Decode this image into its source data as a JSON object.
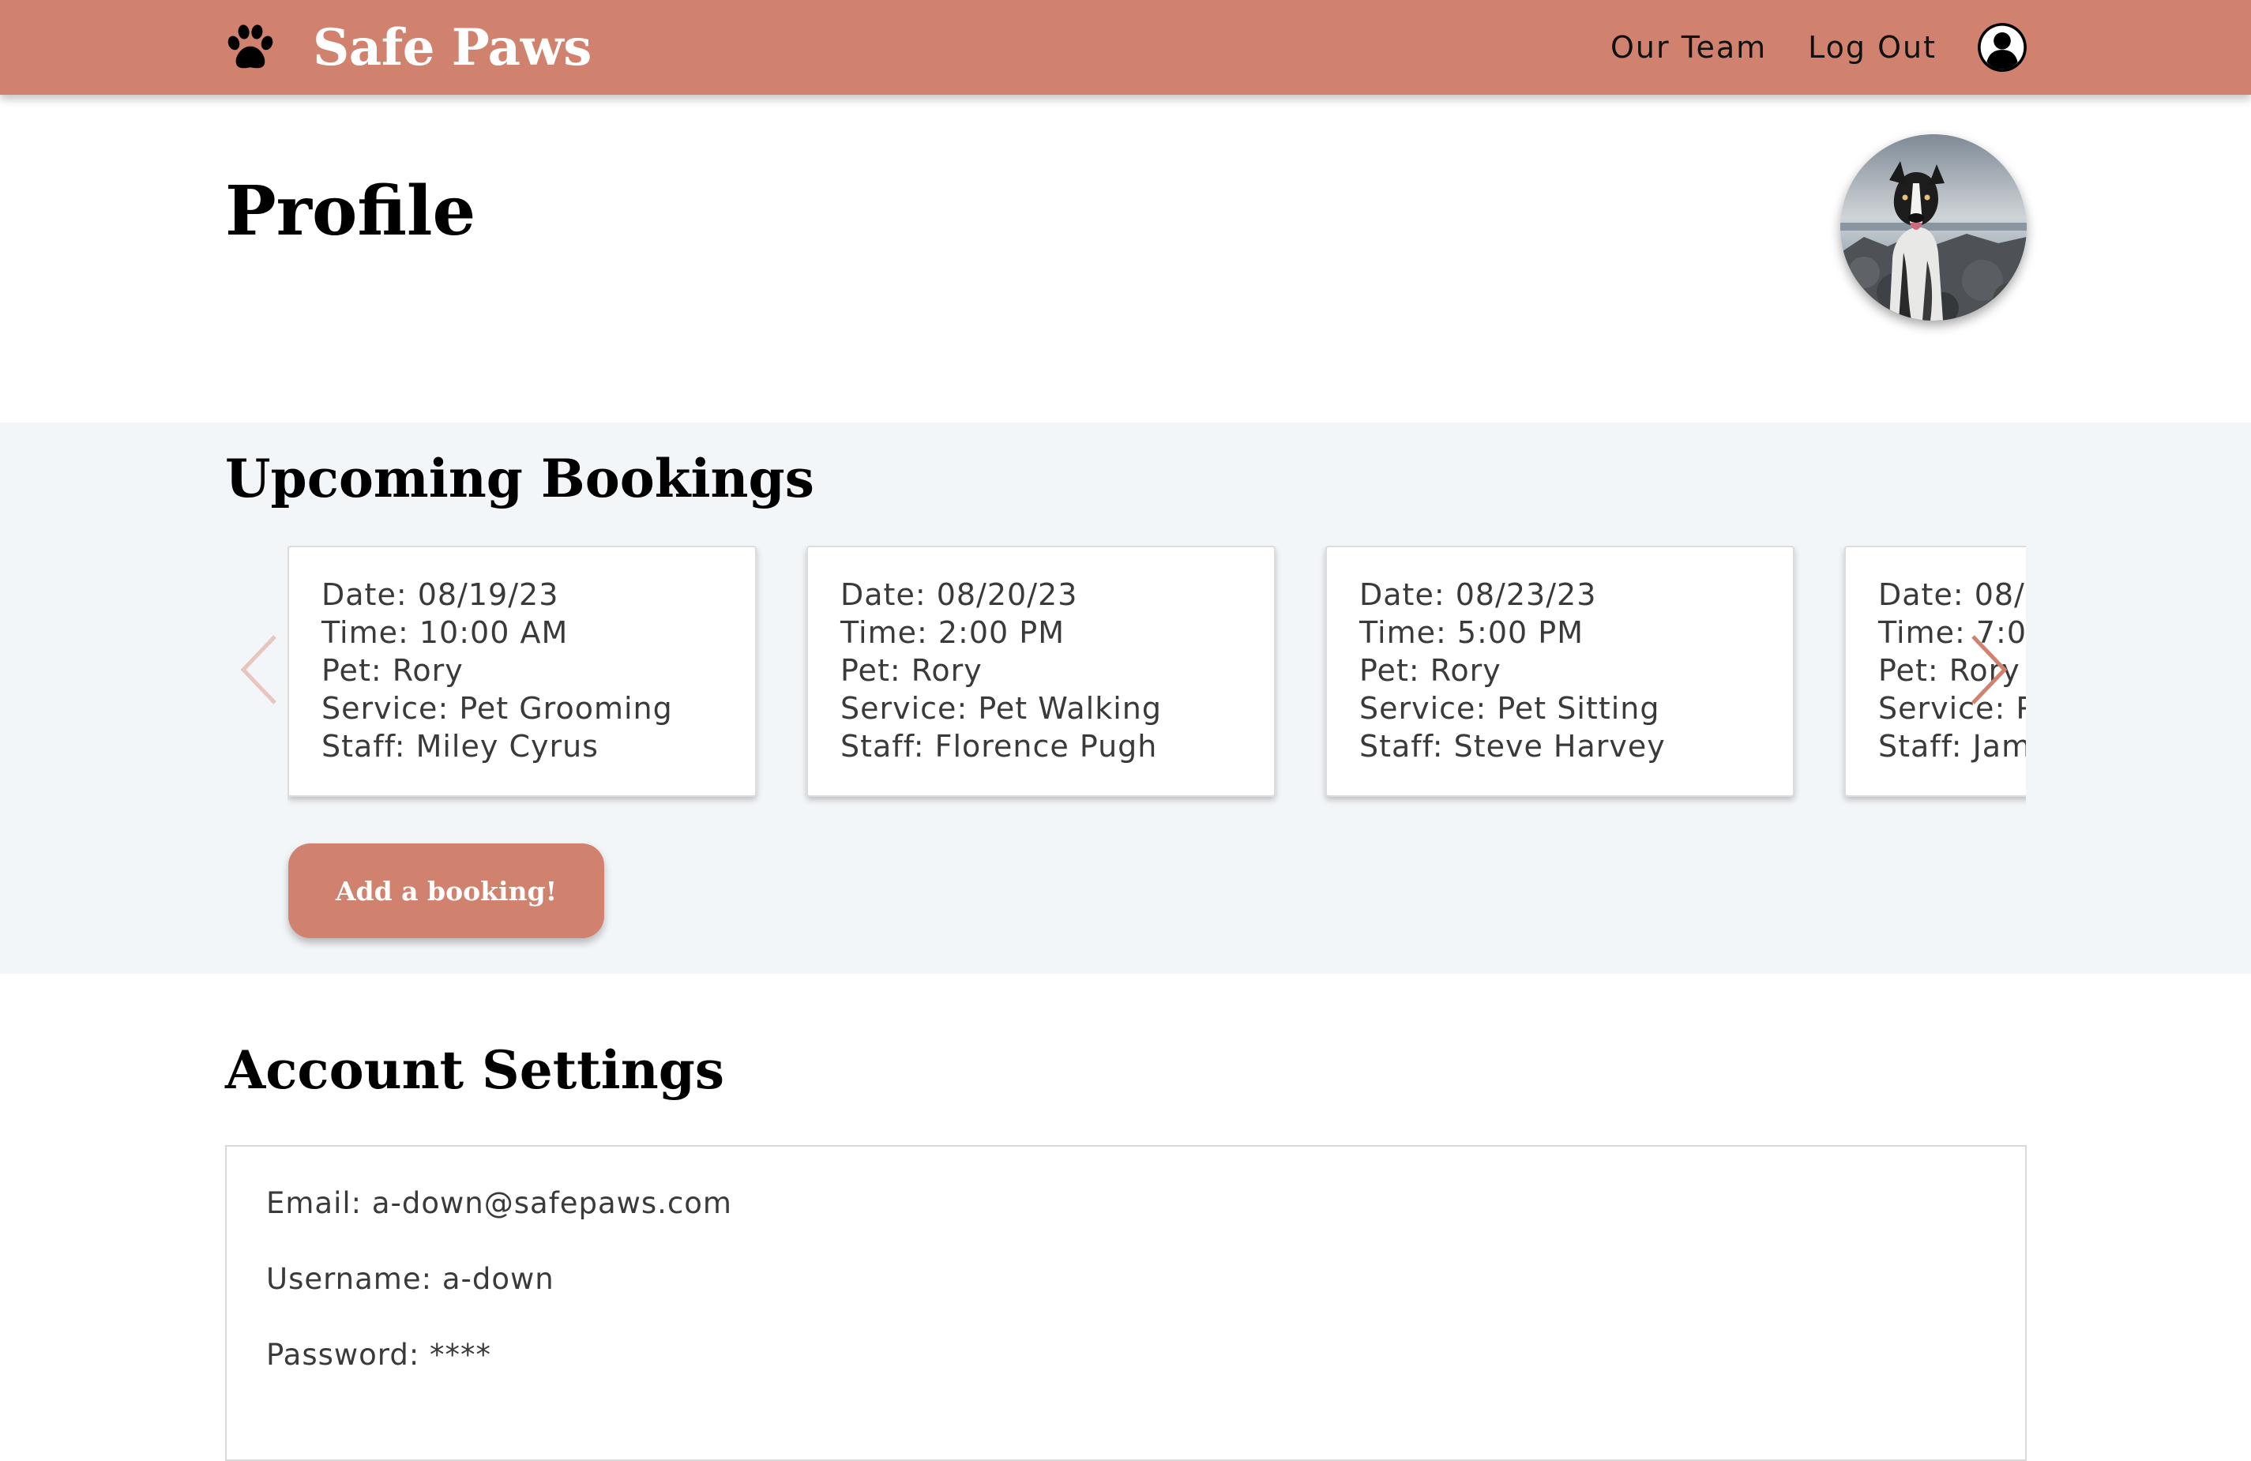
{
  "header": {
    "brand": "Safe Paws",
    "logo_icon": "paw-icon",
    "nav": {
      "our_team": "Our Team",
      "log_out": "Log Out"
    },
    "account_icon": "user-circle-icon"
  },
  "page": {
    "title": "Profile"
  },
  "bookings": {
    "title": "Upcoming Bookings",
    "items": [
      {
        "date": "Date: 08/19/23",
        "time": "Time: 10:00 AM",
        "pet": "Pet: Rory",
        "service": "Service: Pet Grooming",
        "staff": "Staff: Miley Cyrus"
      },
      {
        "date": "Date: 08/20/23",
        "time": "Time: 2:00 PM",
        "pet": "Pet: Rory",
        "service": "Service: Pet Walking",
        "staff": "Staff: Florence Pugh"
      },
      {
        "date": "Date: 08/23/23",
        "time": "Time: 5:00 PM",
        "pet": "Pet: Rory",
        "service": "Service: Pet Sitting",
        "staff": "Staff: Steve Harvey"
      },
      {
        "date": "Date: 08/",
        "time": "Time: 7:0",
        "pet": "Pet: Rory",
        "service": "Service: P",
        "staff": "Staff: Jam"
      }
    ],
    "add_button": "Add a booking!",
    "prev_icon": "chevron-left-icon",
    "next_icon": "chevron-right-icon"
  },
  "settings": {
    "title": "Account Settings",
    "email": "Email: a-down@safepaws.com",
    "username": "Username: a-down",
    "password": "Password: ****"
  },
  "colors": {
    "brand": "#d1826e",
    "section_bg": "#f3f6f9"
  }
}
